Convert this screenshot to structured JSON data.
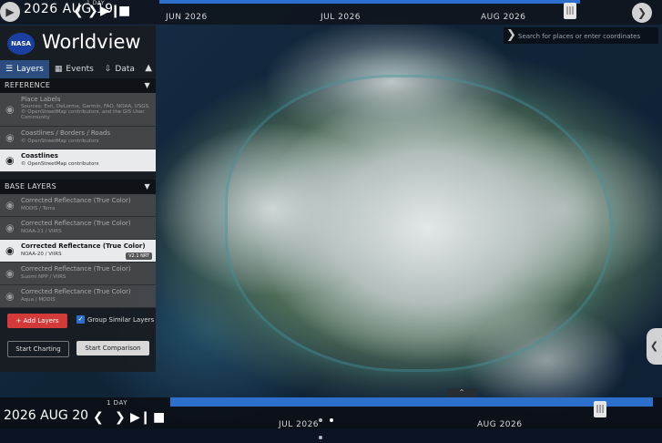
{
  "map": {
    "description": "satellite imagery of a large island covered in clouds"
  },
  "top_timeline": {
    "date": "2026 AUG 19",
    "interval_label": "1 DAY",
    "months": [
      "JUN 2026",
      "JUL 2026",
      "AUG 2026"
    ]
  },
  "search": {
    "placeholder": "Search for places or enter coordinates"
  },
  "sidebar": {
    "app_title": "Worldview",
    "logo_text": "NASA",
    "tabs": [
      {
        "label": "Layers"
      },
      {
        "label": "Events"
      },
      {
        "label": "Data"
      }
    ],
    "reference_header": "REFERENCE",
    "reference_layers": [
      {
        "title": "Place Labels",
        "sub": "Sources: Esri, DeLorme, Garmin, FAO, NOAA, USGS, © OpenStreetMap contributors, and the GIS User Community",
        "visible": false
      },
      {
        "title": "Coastlines / Borders / Roads",
        "sub": "© OpenStreetMap contributors",
        "visible": false
      },
      {
        "title": "Coastlines",
        "sub": "© OpenStreetMap contributors",
        "visible": true
      }
    ],
    "base_header": "BASE LAYERS",
    "base_layers": [
      {
        "title": "Corrected Reflectance (True Color)",
        "sub": "MODIS / Terra",
        "visible": false
      },
      {
        "title": "Corrected Reflectance (True Color)",
        "sub": "NOAA-21 / VIIRS",
        "visible": false
      },
      {
        "title": "Corrected Reflectance (True Color)",
        "sub": "NOAA-20 / VIIRS",
        "visible": true,
        "badge": "V2.1 NRT"
      },
      {
        "title": "Corrected Reflectance (True Color)",
        "sub": "Suomi NPP / VIIRS",
        "visible": false
      },
      {
        "title": "Corrected Reflectance (True Color)",
        "sub": "Aqua / MODIS",
        "visible": false
      }
    ],
    "add_layers_label": "+ Add Layers",
    "group_label": "Group Similar Layers",
    "start_charting_label": "Start Charting",
    "start_comparison_label": "Start Comparison"
  },
  "bottom_timeline": {
    "date": "2026 AUG 20",
    "interval_label": "1 DAY",
    "months": [
      "JUL 2026",
      "AUG 2026"
    ]
  }
}
